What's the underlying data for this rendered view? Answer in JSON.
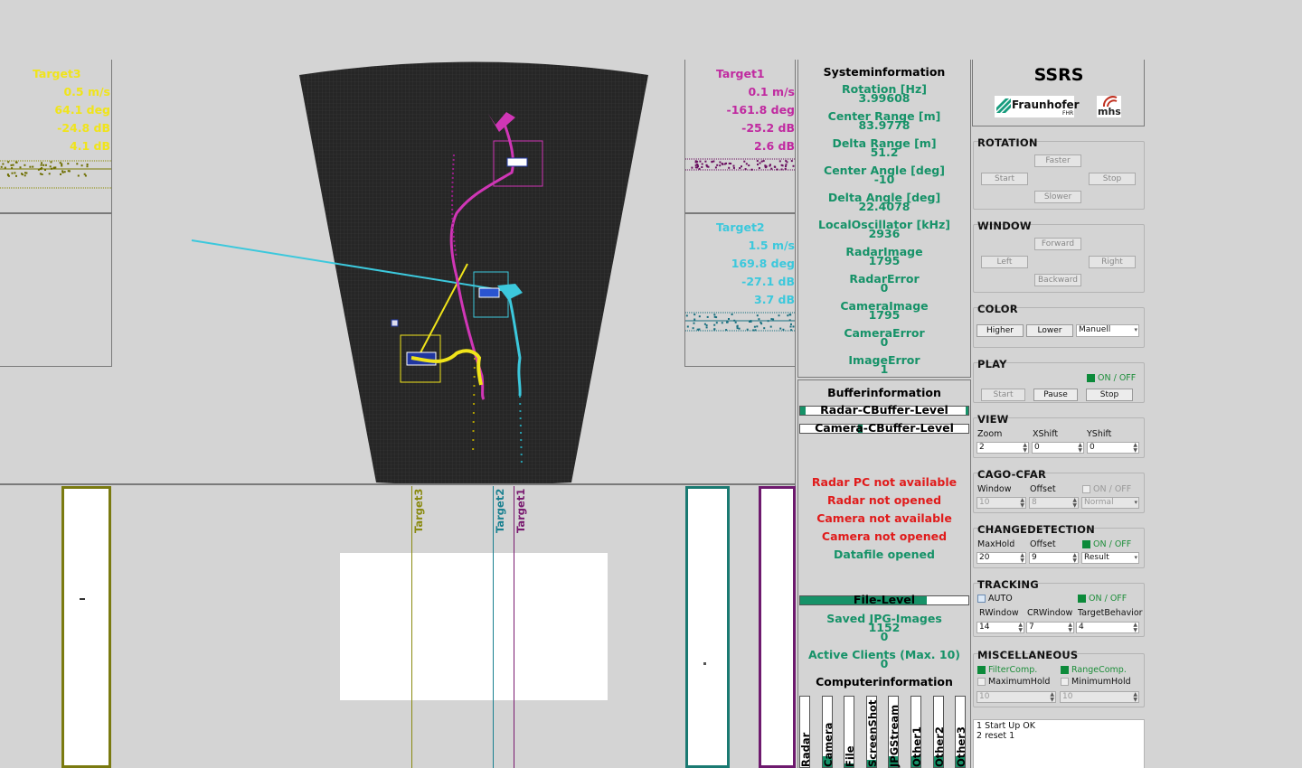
{
  "targets": {
    "target3": {
      "name": "Target3",
      "speed": "0.5 m/s",
      "angle": "64.1 deg",
      "level": "-24.8 dB",
      "snr": "4.1 dB",
      "color": "#f0e41a"
    },
    "target1": {
      "name": "Target1",
      "speed": "0.1 m/s",
      "angle": "-161.8 deg",
      "level": "-25.2 dB",
      "snr": "2.6 dB",
      "color": "#c02aa0"
    },
    "target2": {
      "name": "Target2",
      "speed": "1.5 m/s",
      "angle": "169.8 deg",
      "level": "-27.1 dB",
      "snr": "3.7 dB",
      "color": "#3cc8dc"
    }
  },
  "bottom_labels": {
    "target3": "Target3",
    "target2": "Target2",
    "target1": "Target1"
  },
  "sysinfo": {
    "title": "Systeminformation",
    "items": [
      {
        "label": "Rotation [Hz]",
        "value": "3.99608"
      },
      {
        "label": "Center Range [m]",
        "value": "83.9778"
      },
      {
        "label": "Delta Range [m]",
        "value": "51.2"
      },
      {
        "label": "Center Angle [deg]",
        "value": "-10"
      },
      {
        "label": "Delta Angle [deg]",
        "value": "22.4078"
      },
      {
        "label": "LocalOscillator [kHz]",
        "value": "2936"
      },
      {
        "label": "RadarImage",
        "value": "1795"
      },
      {
        "label": "RadarError",
        "value": "0"
      },
      {
        "label": "CameraImage",
        "value": "1795"
      },
      {
        "label": "CameraError",
        "value": "0"
      },
      {
        "label": "ImageError",
        "value": "1"
      }
    ]
  },
  "buffer": {
    "title": "Bufferinformation",
    "radar_label": "Radar-CBuffer-Level",
    "camera_label": "Camera-CBuffer-Level"
  },
  "status": {
    "lines": [
      "Radar PC not available",
      "Radar not opened",
      "Camera not available",
      "Camera not opened"
    ],
    "datafile": "Datafile opened"
  },
  "file": {
    "level_label": "File-Level",
    "saved_label": "Saved JPG-Images",
    "saved_value": "1152",
    "saved_value2": "0",
    "clients_label": "Active Clients (Max. 10)",
    "clients_value": "0"
  },
  "computer": {
    "title": "Computerinformation",
    "bars": [
      {
        "label": "Radar",
        "fill": 0.0
      },
      {
        "label": "Camera",
        "fill": 0.15
      },
      {
        "label": "File",
        "fill": 0.05
      },
      {
        "label": "ScreenShot",
        "fill": 0.1
      },
      {
        "label": "JPGStream",
        "fill": 0.15
      },
      {
        "label": "Other1",
        "fill": 0.15
      },
      {
        "label": "Other2",
        "fill": 0.15
      },
      {
        "label": "Other3",
        "fill": 0.15
      }
    ]
  },
  "logo": {
    "title": "SSRS",
    "fraunhofer": "Fraunhofer",
    "fhr": "FHR",
    "mhs": "mhs"
  },
  "rotation": {
    "title": "ROTATION",
    "faster": "Faster",
    "start": "Start",
    "stop": "Stop",
    "slower": "Slower"
  },
  "window": {
    "title": "WINDOW",
    "forward": "Forward",
    "left": "Left",
    "right": "Right",
    "backward": "Backward"
  },
  "color": {
    "title": "COLOR",
    "higher": "Higher",
    "lower": "Lower",
    "mode": "Manuell"
  },
  "play": {
    "title": "PLAY",
    "onoff": "ON / OFF",
    "start": "Start",
    "pause": "Pause",
    "stop": "Stop"
  },
  "view": {
    "title": "VIEW",
    "zoom_label": "Zoom",
    "xshift_label": "XShift",
    "yshift_label": "YShift",
    "zoom": "2",
    "xshift": "0",
    "yshift": "0"
  },
  "cago": {
    "title": "CAGO-CFAR",
    "window_label": "Window",
    "offset_label": "Offset",
    "onoff": "ON / OFF",
    "window": "10",
    "offset": "8",
    "mode": "Normal"
  },
  "change": {
    "title": "CHANGEDETECTION",
    "maxhold_label": "MaxHold",
    "offset_label": "Offset",
    "onoff": "ON / OFF",
    "maxhold": "20",
    "offset": "9",
    "mode": "Result"
  },
  "tracking": {
    "title": "TRACKING",
    "auto": "AUTO",
    "onoff": "ON / OFF",
    "rwindow_label": "RWindow",
    "crwindow_label": "CRWindow",
    "behavior_label": "TargetBehavior",
    "rwindow": "14",
    "crwindow": "7",
    "behavior": "4"
  },
  "misc": {
    "title": "MISCELLANEOUS",
    "filtercomp": "FilterComp.",
    "rangecomp": "RangeComp.",
    "maxhold": "MaximumHold",
    "minhold": "MinimumHold",
    "v1": "10",
    "v2": "10"
  },
  "log": [
    "1 Start Up OK",
    "2 reset 1"
  ]
}
